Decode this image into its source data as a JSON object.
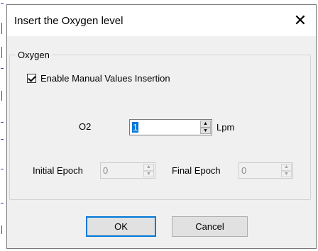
{
  "dialog": {
    "title": "Insert the Oxygen level",
    "close_glyph": "✕"
  },
  "group": {
    "legend": "Oxygen",
    "enable_manual": {
      "label": "Enable Manual Values Insertion",
      "checked": true
    },
    "o2": {
      "label": "O2",
      "value": "1",
      "unit": "Lpm"
    },
    "initial_epoch": {
      "label": "Initial Epoch",
      "value": "0",
      "enabled": false
    },
    "final_epoch": {
      "label": "Final Epoch",
      "value": "0",
      "enabled": false
    }
  },
  "buttons": {
    "ok": "OK",
    "cancel": "Cancel"
  },
  "colors": {
    "accent": "#0078d7",
    "dialog_bg": "#f0f0f0"
  }
}
